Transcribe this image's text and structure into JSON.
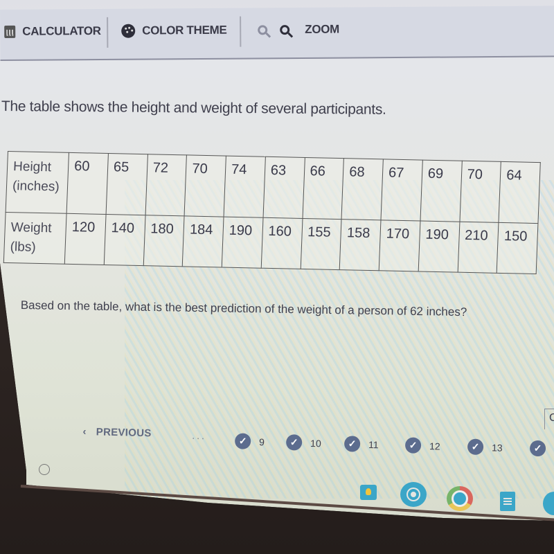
{
  "toolbar": {
    "calculator_label": "CALCULATOR",
    "color_theme_label": "COLOR THEME",
    "zoom_label": "ZOOM"
  },
  "prompt": "The table shows the height and weight of several participants.",
  "table": {
    "rows": [
      {
        "header_line1": "Height",
        "header_line2": "(inches)",
        "values": [
          "60",
          "65",
          "72",
          "70",
          "74",
          "63",
          "66",
          "68",
          "67",
          "69",
          "70",
          "64"
        ]
      },
      {
        "header_line1": "Weight",
        "header_line2": "(lbs)",
        "values": [
          "120",
          "140",
          "180",
          "184",
          "190",
          "160",
          "155",
          "158",
          "170",
          "190",
          "210",
          "150"
        ]
      }
    ]
  },
  "question": "Based on the table, what is the best prediction of the weight of a person of 62 inches?",
  "navigation": {
    "previous_label": "PREVIOUS",
    "previous_chevron": "‹",
    "ellipsis": "...",
    "questions": [
      {
        "number": "9",
        "status": "answered"
      },
      {
        "number": "10",
        "status": "answered"
      },
      {
        "number": "11",
        "status": "answered"
      },
      {
        "number": "12",
        "status": "answered"
      },
      {
        "number": "13",
        "status": "answered"
      },
      {
        "number": "",
        "status": "answered"
      }
    ],
    "cut_button_label": "C"
  },
  "shelf": {
    "apps": [
      "keep-icon",
      "camera-icon",
      "chrome-icon",
      "docs-icon",
      "app-icon"
    ]
  },
  "colors": {
    "check_badge": "#5c6c8e",
    "toolbar_bg": "#d6d9e3",
    "text": "#3f3f4d",
    "shelf_accent": "#3ba6c8"
  }
}
